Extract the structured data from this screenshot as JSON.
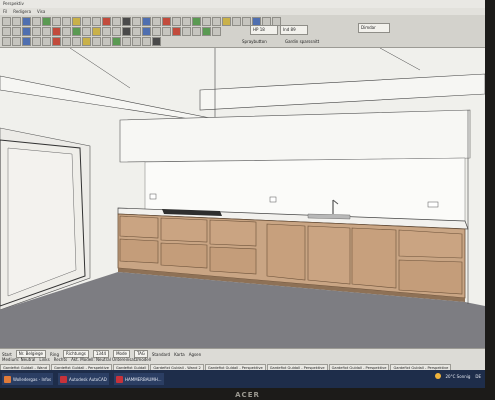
{
  "window": {
    "title": "Perspektiv"
  },
  "menu": {
    "items": [
      "Fil",
      "Redigera",
      "Visa"
    ]
  },
  "toolbar": {
    "scale_value": "HP 18",
    "opt_value": "Ind 89",
    "sprayreturn_label": "Spraybutton",
    "fill_label": "Gardin sparssnitt",
    "render_label": "Dimdar"
  },
  "status": {
    "start_label": "Start",
    "start_value": "Nr. Belgiege",
    "ring_label": "Ring",
    "ring_value": "Richtungs",
    "extra_a": "1344",
    "extra_b": "Mode",
    "extra_c": "TAG",
    "standard_label": "Standard",
    "cursor_label": "Karta",
    "angle_label": "Agsen",
    "second_row_a": "Medium: Neutral",
    "second_row_b": "Links",
    "second_row_c": "Rechts",
    "model_label": "Akt. Modell: Neutral Untereinsatzmodell"
  },
  "view_tabs": [
    "Gardefixt Guldall - Wand",
    "Gardefixt Guldall - Perspektive",
    "Gardefixt Guldall",
    "Gardefixt Guldall - Wand 2",
    "Gardefixt Guldall - Perspektive",
    "Gardefixt Guldall - Perspektive",
    "Gardefixt Guldall - Perspektive",
    "Gardefixt Guldall - Perspektive"
  ],
  "taskbar": {
    "items": [
      {
        "label": "Wolledergas - Infos",
        "color": "#e07b3a"
      },
      {
        "label": "Autodesk AutoCAD",
        "color": "#c7323a"
      },
      {
        "label": "HAMMERBAUMH...",
        "color": "#c7323a"
      }
    ],
    "temp": "20°C Sonnig",
    "lang": "DE"
  },
  "monitor": {
    "brand": "ACER"
  },
  "colors": {
    "cabinet": "#c9a584",
    "floor": "#7d7d82",
    "wall": "#f2f2ef",
    "taskbar": "#1e2d4a"
  }
}
